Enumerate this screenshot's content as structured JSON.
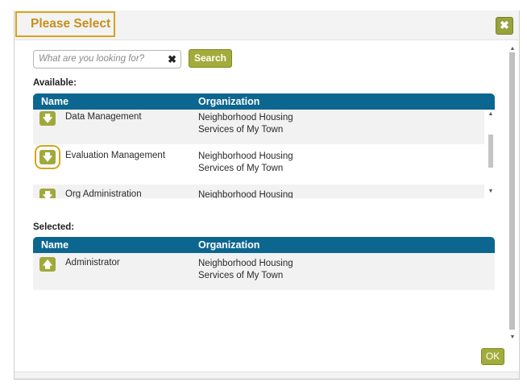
{
  "dialog": {
    "title": "Please Select",
    "close_glyph": "✖",
    "ok_label": "OK"
  },
  "search": {
    "placeholder": "What are you looking for?",
    "value": "",
    "clear_glyph": "✖",
    "button_label": "Search"
  },
  "available": {
    "label": "Available:",
    "columns": {
      "name": "Name",
      "organization": "Organization"
    },
    "rows": [
      {
        "name": "Data Management",
        "org_line1": "Neighborhood Housing",
        "org_line2": "Services of My Town",
        "action_icon": "arrow-down-icon"
      },
      {
        "name": "Evaluation Management",
        "org_line1": "Neighborhood Housing",
        "org_line2": "Services of My Town",
        "action_icon": "arrow-down-icon"
      },
      {
        "name": "Org Administration",
        "org_line1": "Neighborhood Housing",
        "org_line2": "",
        "action_icon": "arrow-down-icon"
      }
    ]
  },
  "selected": {
    "label": "Selected:",
    "columns": {
      "name": "Name",
      "organization": "Organization"
    },
    "rows": [
      {
        "name": "Administrator",
        "org_line1": "Neighborhood Housing",
        "org_line2": "Services of My Town",
        "action_icon": "arrow-up-icon"
      }
    ]
  },
  "colors": {
    "accent_green": "#a3ac3b",
    "header_blue": "#0c6690",
    "highlight_orange": "#d8a41d"
  }
}
